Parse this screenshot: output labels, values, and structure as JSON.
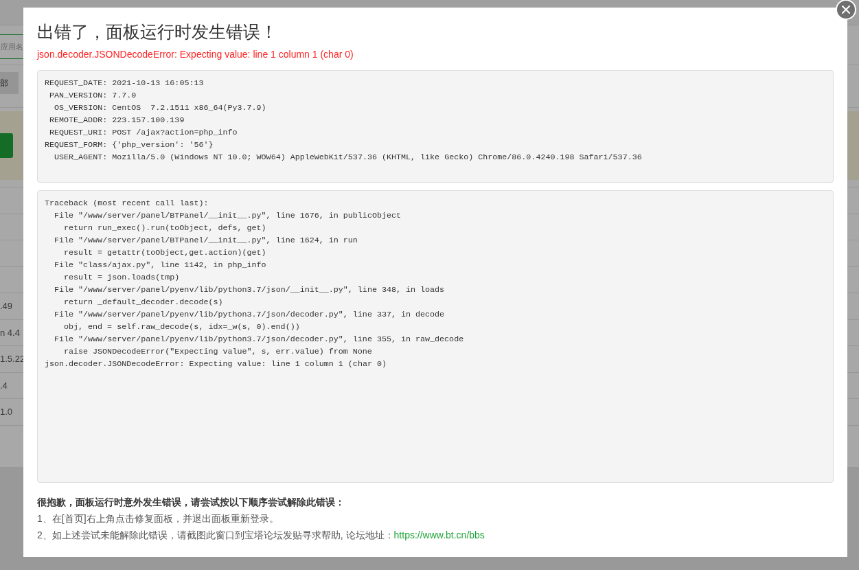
{
  "background": {
    "search": {
      "placeholder": "应用名"
    },
    "filter_button": "部",
    "table": {
      "rows": [
        {
          "column_1": ".49"
        },
        {
          "column_1": "n 4.4"
        },
        {
          "column_1": "1.5.22"
        },
        {
          "column_1": ".4"
        },
        {
          "column_1": "1.0"
        }
      ]
    }
  },
  "dialog": {
    "title": "出错了，面板运行时发生错误！",
    "error": "json.decoder.JSONDecodeError: Expecting value: line 1 column 1 (char 0)",
    "request_info": [
      {
        "key": "REQUEST_DATE:",
        "value": "2021-10-13 16:05:13"
      },
      {
        "key": "PAN_VERSION:",
        "value": "7.7.0"
      },
      {
        "key": "OS_VERSION:",
        "value": "CentOS  7.2.1511 x86_64(Py3.7.9)"
      },
      {
        "key": "REMOTE_ADDR:",
        "value": "223.157.100.139"
      },
      {
        "key": "REQUEST_URI:",
        "value": "POST /ajax?action=php_info"
      },
      {
        "key": "REQUEST_FORM:",
        "value": "{'php_version': '56'}"
      },
      {
        "key": "USER_AGENT:",
        "value": "Mozilla/5.0 (Windows NT 10.0; WOW64) AppleWebKit/537.36 (KHTML, like Gecko) Chrome/86.0.4240.198 Safari/537.36"
      }
    ],
    "traceback": {
      "header": "Traceback (most recent call last):",
      "frames": [
        {
          "location": "File \"/www/server/panel/BTPanel/__init__.py\", line 1676, in publicObject",
          "code": "return run_exec().run(toObject, defs, get)"
        },
        {
          "location": "File \"/www/server/panel/BTPanel/__init__.py\", line 1624, in run",
          "code": "result = getattr(toObject,get.action)(get)"
        },
        {
          "location": "File \"class/ajax.py\", line 1142, in php_info",
          "code": "result = json.loads(tmp)"
        },
        {
          "location": "File \"/www/server/panel/pyenv/lib/python3.7/json/__init__.py\", line 348, in loads",
          "code": "return _default_decoder.decode(s)"
        },
        {
          "location": "File \"/www/server/panel/pyenv/lib/python3.7/json/decoder.py\", line 337, in decode",
          "code": "obj, end = self.raw_decode(s, idx=_w(s, 0).end())"
        },
        {
          "location": "File \"/www/server/panel/pyenv/lib/python3.7/json/decoder.py\", line 355, in raw_decode",
          "code": "raise JSONDecodeError(\"Expecting value\", s, err.value) from None"
        }
      ],
      "error": "json.decoder.JSONDecodeError: Expecting value: line 1 column 1 (char 0)"
    },
    "help": {
      "heading": "很抱歉，面板运行时意外发生错误，请尝试按以下顺序尝试解除此错误：",
      "steps": [
        {
          "text": "1、在[首页]右上角点击修复面板，并退出面板重新登录。"
        },
        {
          "text": "2、如上述尝试未能解除此错误，请截图此窗口到宝塔论坛发贴寻求帮助, 论坛地址：",
          "link": "https://www.bt.cn/bbs"
        }
      ]
    }
  }
}
